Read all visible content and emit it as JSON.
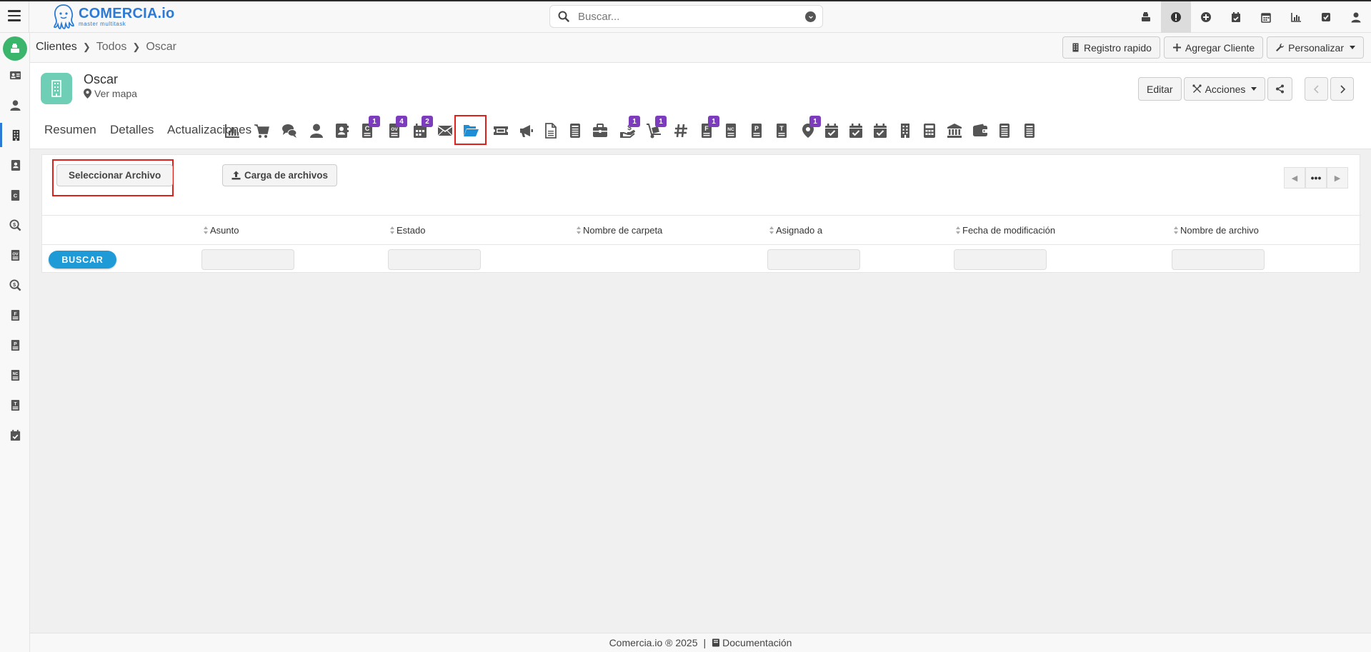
{
  "header": {
    "brand_title": "COMERCIA.io",
    "brand_subtitle": "master multitask",
    "search_placeholder": "Buscar..."
  },
  "top_icons": [
    "cash-register-icon",
    "alert-icon",
    "plus-circle-icon",
    "calendar-check-icon",
    "calendar-icon",
    "chart-bar-icon",
    "checkbox-icon",
    "user-icon"
  ],
  "sidebar_icons": [
    "id-card-icon",
    "user-icon",
    "building-icon",
    "contact-book-icon",
    "quote-c-icon",
    "search-dollar-icon",
    "ov-document-icon",
    "search-dollar-icon",
    "invoice-f-icon",
    "p-document-icon",
    "nc-document-icon",
    "t-document-icon",
    "calendar-check-icon"
  ],
  "breadcrumb": {
    "items": [
      "Clientes",
      "Todos",
      "Oscar"
    ]
  },
  "crumb_actions": {
    "quick_register": "Registro rapido",
    "add_client": "Agregar Cliente",
    "customize": "Personalizar"
  },
  "record": {
    "name": "Oscar",
    "map_link": "Ver mapa",
    "edit": "Editar",
    "actions": "Acciones"
  },
  "tabs": {
    "summary": "Resumen",
    "details": "Detalles",
    "updates": "Actualizaciones",
    "icons": [
      {
        "name": "chart-icon",
        "badge": ""
      },
      {
        "name": "cart-icon",
        "badge": ""
      },
      {
        "name": "comments-icon",
        "badge": ""
      },
      {
        "name": "user-icon",
        "badge": ""
      },
      {
        "name": "address-book-icon",
        "badge": ""
      },
      {
        "name": "quote-icon",
        "badge": "1"
      },
      {
        "name": "order-icon",
        "badge": "4"
      },
      {
        "name": "calendar-grid-icon",
        "badge": "2"
      },
      {
        "name": "envelope-icon",
        "badge": ""
      },
      {
        "name": "folder-open-icon",
        "badge": ""
      },
      {
        "name": "ticket-icon",
        "badge": ""
      },
      {
        "name": "megaphone-icon",
        "badge": ""
      },
      {
        "name": "file-icon",
        "badge": ""
      },
      {
        "name": "receipt-icon",
        "badge": ""
      },
      {
        "name": "briefcase-icon",
        "badge": ""
      },
      {
        "name": "hand-dollar-icon",
        "badge": "1"
      },
      {
        "name": "dolly-icon",
        "badge": "1"
      },
      {
        "name": "hashtag-icon",
        "badge": ""
      },
      {
        "name": "invoice-icon",
        "badge": "1"
      },
      {
        "name": "credit-note-icon",
        "badge": ""
      },
      {
        "name": "p-doc-icon",
        "badge": ""
      },
      {
        "name": "t-doc-icon",
        "badge": ""
      },
      {
        "name": "map-pin-icon",
        "badge": "1"
      },
      {
        "name": "calendar-check-icon",
        "badge": ""
      },
      {
        "name": "calendar-check-icon",
        "badge": ""
      },
      {
        "name": "calendar-check-icon",
        "badge": ""
      },
      {
        "name": "building-icon",
        "badge": ""
      },
      {
        "name": "calculator-icon",
        "badge": ""
      },
      {
        "name": "bank-icon",
        "badge": ""
      },
      {
        "name": "wallet-icon",
        "badge": ""
      },
      {
        "name": "receipt-icon",
        "badge": ""
      },
      {
        "name": "receipt-icon",
        "badge": ""
      }
    ]
  },
  "files": {
    "select_file": "Seleccionar Archivo",
    "upload": "Carga de archivos",
    "columns": [
      "Asunto",
      "Estado",
      "Nombre de carpeta",
      "Asignado a",
      "Fecha de modificación",
      "Nombre de archivo"
    ],
    "search_button": "BUSCAR"
  },
  "footer": {
    "copyright": "Comercia.io ® 2025",
    "separator": "|",
    "docs": "Documentación"
  }
}
